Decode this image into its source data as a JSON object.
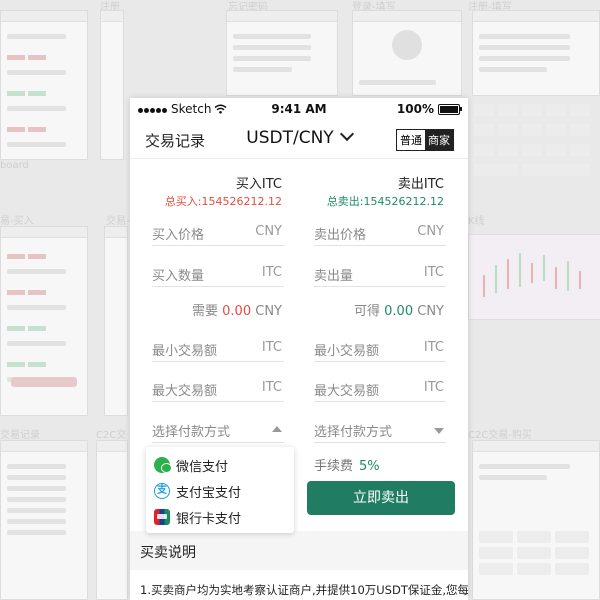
{
  "status_bar": {
    "carrier": "Sketch",
    "time": "9:41 AM",
    "battery": "100%"
  },
  "nav": {
    "left_label": "交易记录",
    "title": "USDT/CNY",
    "mode_normal": "普通",
    "mode_merchant": "商家"
  },
  "buy": {
    "title": "买入ITC",
    "total_label": "总买入:154526212.12",
    "price_label": "买入价格",
    "price_unit": "CNY",
    "qty_label": "买入数量",
    "qty_unit": "ITC",
    "need_prefix": "需要",
    "need_amount": "0.00",
    "need_unit": "CNY",
    "min_label": "最小交易额",
    "min_unit": "ITC",
    "max_label": "最大交易额",
    "max_unit": "ITC",
    "pay_label": "选择付款方式"
  },
  "sell": {
    "title": "卖出ITC",
    "total_label": "总卖出:154526212.12",
    "price_label": "卖出价格",
    "price_unit": "CNY",
    "qty_label": "卖出量",
    "qty_unit": "ITC",
    "avail_prefix": "可得",
    "avail_amount": "0.00",
    "avail_unit": "CNY",
    "min_label": "最小交易额",
    "min_unit": "ITC",
    "max_label": "最大交易额",
    "max_unit": "ITC",
    "pay_label": "选择付款方式",
    "fee_label": "手续费",
    "fee_value": "5%",
    "submit_label": "立即卖出"
  },
  "payment_options": [
    {
      "label": "微信支付",
      "icon": "wechat-icon"
    },
    {
      "label": "支付宝支付",
      "icon": "alipay-icon"
    },
    {
      "label": "银行卡支付",
      "icon": "unionpay-icon"
    }
  ],
  "notes": {
    "heading": "买卖说明",
    "line1": "1.买卖商户均为实地考察认证商户,并提供10万USDT保证金,您每"
  },
  "background_labels": {
    "register": "注册",
    "forgot": "忘记密码",
    "login": "登录-填写",
    "register_fill": "注册-填写",
    "dashboard": "board",
    "trade_buy": "易-买入",
    "trade": "交易-",
    "kline": "K线",
    "trade_records": "交易记录",
    "c2c": "C2C交",
    "c2c_buy": "C2C交易-购买"
  },
  "colors": {
    "buy_red": "#e74c3c",
    "sell_green": "#1e8a6a",
    "button_green": "#207d63"
  }
}
